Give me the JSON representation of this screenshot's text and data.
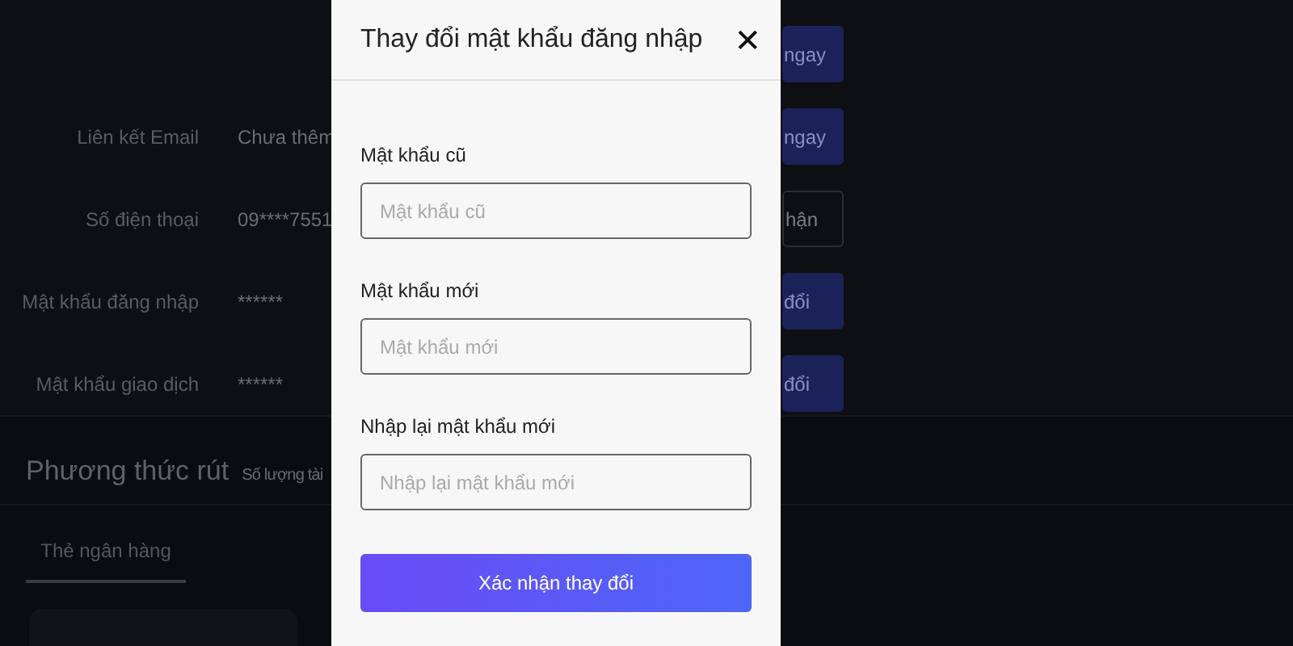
{
  "profile_rows": [
    {
      "button": {
        "label": "ngay",
        "kind": "filled"
      }
    },
    {
      "label": "Liên kết Email",
      "value": "Chưa thêm",
      "button": {
        "label": "ngay",
        "kind": "filled"
      }
    },
    {
      "label": "Số điện thoại",
      "value": "09****7551",
      "button": {
        "label": "hận",
        "kind": "outline"
      }
    },
    {
      "label": "Mật khẩu đăng nhập",
      "value": "******",
      "button": {
        "label": "đổi",
        "kind": "filled"
      }
    },
    {
      "label": "Mật khẩu giao dịch",
      "value": "******",
      "button": {
        "label": "đổi",
        "kind": "filled"
      }
    }
  ],
  "withdraw": {
    "title": "Phương thức rút",
    "subtitle": "Số lượng tài",
    "tabs": [
      {
        "label": "Thẻ ngân hàng",
        "selected": true
      }
    ]
  },
  "modal": {
    "title": "Thay đổi mật khẩu đăng nhập",
    "close": "✕",
    "fields": [
      {
        "label": "Mật khẩu cũ",
        "placeholder": "Mật khẩu cũ"
      },
      {
        "label": "Mật khẩu mới",
        "placeholder": "Mật khẩu mới"
      },
      {
        "label": "Nhập lại mật khẩu mới",
        "placeholder": "Nhập lại mật khẩu mới"
      }
    ],
    "submit": "Xác nhận thay đổi"
  }
}
